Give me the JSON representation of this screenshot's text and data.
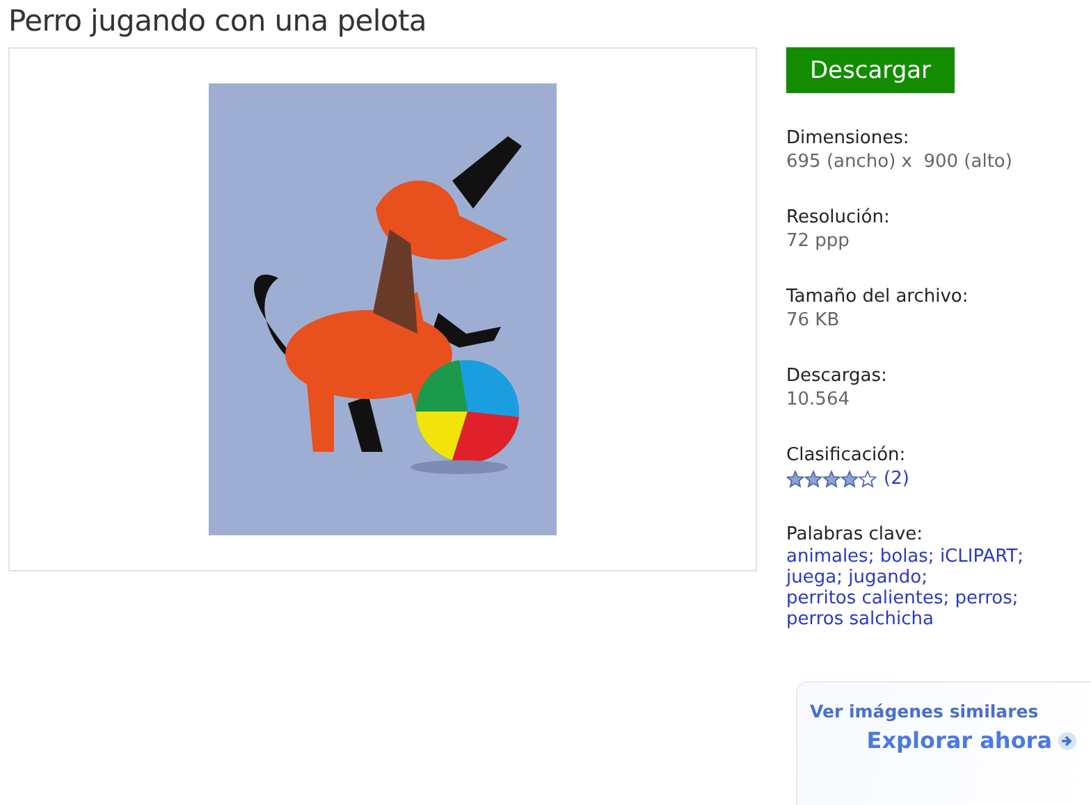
{
  "title": "Perro jugando con una pelota",
  "download_button": "Descargar",
  "details": [
    {
      "label": "Dimensiones:",
      "value": "695 (ancho) x  900 (alto)"
    },
    {
      "label": "Resolución:",
      "value": "72 ppp"
    },
    {
      "label": "Tamaño del archivo:",
      "value": "76 KB"
    },
    {
      "label": "Descargas:",
      "value": "10.564"
    }
  ],
  "rating": {
    "label": "Clasificación:",
    "stars": 4,
    "count": "(2)"
  },
  "keywords": {
    "label": "Palabras clave:",
    "items": [
      "animales;",
      "bolas;",
      "iCLIPART;",
      "juega;",
      "jugando;",
      "perritos calientes;",
      "perros;",
      "perros salchicha"
    ]
  },
  "similar": {
    "heading": "Ver imágenes similares",
    "link": "Explorar ahora"
  }
}
